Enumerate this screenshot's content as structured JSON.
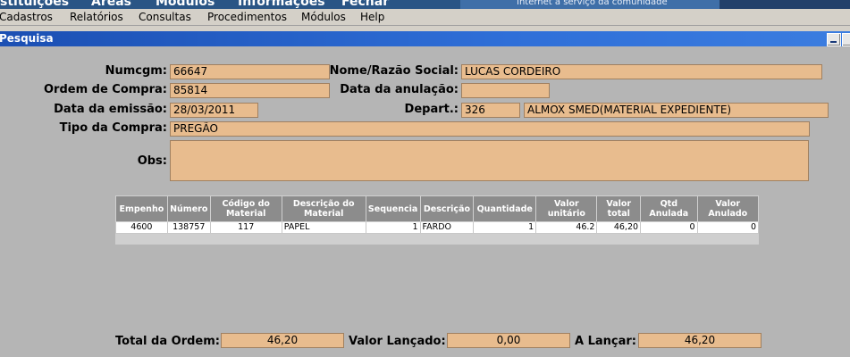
{
  "top_menu": {
    "items": [
      "stituições",
      "Areas",
      "Módulos",
      "Informações",
      "Fechar"
    ],
    "tagline": "Internet a serviço da comunidade"
  },
  "menubar": {
    "items": [
      "Cadastros",
      "Relatórios",
      "Consultas",
      "Procedimentos",
      "Módulos",
      "Help"
    ]
  },
  "window": {
    "title": "Pesquisa"
  },
  "form": {
    "numcgm_label": "Numcgm:",
    "numcgm": "66647",
    "nome_label": "Nome/Razão Social:",
    "nome": "LUCAS CORDEIRO",
    "ordem_label": "Ordem de Compra:",
    "ordem": "85814",
    "anulacao_label": "Data da anulação:",
    "anulacao": "",
    "emissao_label": "Data da emissão:",
    "emissao": "28/03/2011",
    "depart_label": "Depart.:",
    "depart_code": "326",
    "depart_name": "ALMOX SMED(MATERIAL EXPEDIENTE)",
    "tipo_label": "Tipo da Compra:",
    "tipo": "PREGÃO",
    "obs_label": "Obs:",
    "obs": ""
  },
  "table": {
    "headers": [
      "Empenho",
      "Número",
      "Código do Material",
      "Descrição do Material",
      "Sequencia",
      "Descrição",
      "Quantidade",
      "Valor unitário",
      "Valor total",
      "Qtd Anulada",
      "Valor Anulado"
    ],
    "rows": [
      [
        "4600",
        "138757",
        "117",
        "PAPEL",
        "1",
        "FARDO",
        "1",
        "46.2",
        "46,20",
        "0",
        "0"
      ]
    ]
  },
  "totals": {
    "total_label": "Total da Ordem:",
    "total": "46,20",
    "lancado_label": "Valor Lançado:",
    "lancado": "0,00",
    "alancar_label": "A Lançar:",
    "alancar": "46,20"
  }
}
